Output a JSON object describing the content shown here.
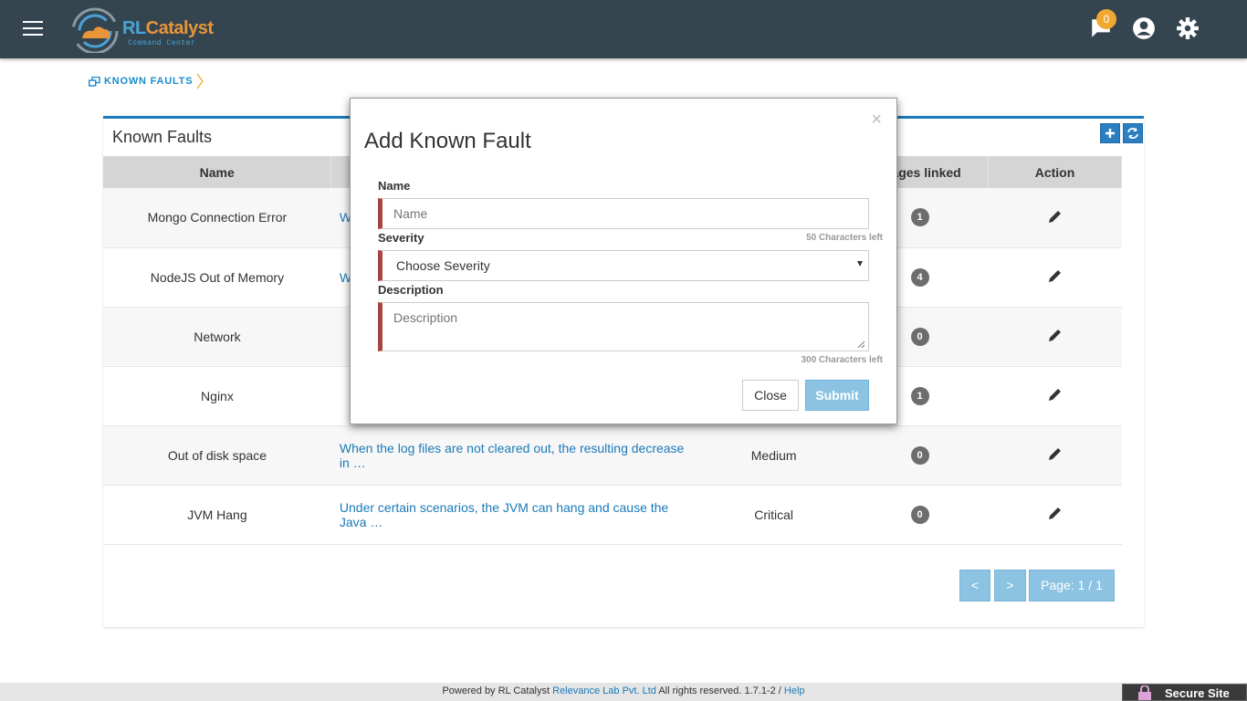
{
  "header": {
    "logo_text_a": "RL",
    "logo_text_b": "Catalyst",
    "logo_sub": "Command Center",
    "notification_count": "0"
  },
  "breadcrumb": {
    "label": "KNOWN FAULTS"
  },
  "panel": {
    "title": "Known Faults",
    "columns": [
      "Name",
      "",
      "",
      "Stages linked",
      "Action"
    ],
    "rows": [
      {
        "name": "Mongo Connection Error",
        "description": "W",
        "severity": "",
        "count": "1"
      },
      {
        "name": "NodeJS Out of Memory",
        "description": "W",
        "severity": "",
        "count": "4"
      },
      {
        "name": "Network",
        "description": "",
        "severity": "",
        "count": "0"
      },
      {
        "name": "Nginx",
        "description": "",
        "severity": "",
        "count": "1"
      },
      {
        "name": "Out of disk space",
        "description": "When the log files are not cleared out, the resulting decrease in …",
        "severity": "Medium",
        "count": "0"
      },
      {
        "name": "JVM Hang",
        "description": "Under certain scenarios, the JVM can hang and cause the Java …",
        "severity": "Critical",
        "count": "0"
      }
    ],
    "pager": {
      "prev": "<",
      "next": ">",
      "page": "Page: 1 / 1"
    }
  },
  "modal": {
    "close_x": "×",
    "title": "Add Known Fault",
    "name_label": "Name",
    "name_placeholder": "Name",
    "name_hint": "50 Characters left",
    "severity_label": "Severity",
    "severity_selected": "Choose Severity",
    "description_label": "Description",
    "description_placeholder": "Description",
    "description_hint": "300 Characters left",
    "close_button": "Close",
    "submit_button": "Submit"
  },
  "footer": {
    "prefix": "Powered by RL Catalyst ",
    "company": "Relevance Lab Pvt. Ltd",
    "rights": " All rights reserved. 1.7.1-2 / ",
    "help": "Help",
    "secure": "Secure Site"
  },
  "colors": {
    "topbar": "#34454f",
    "accent": "#1a7ab8",
    "invalid": "#a94442"
  }
}
